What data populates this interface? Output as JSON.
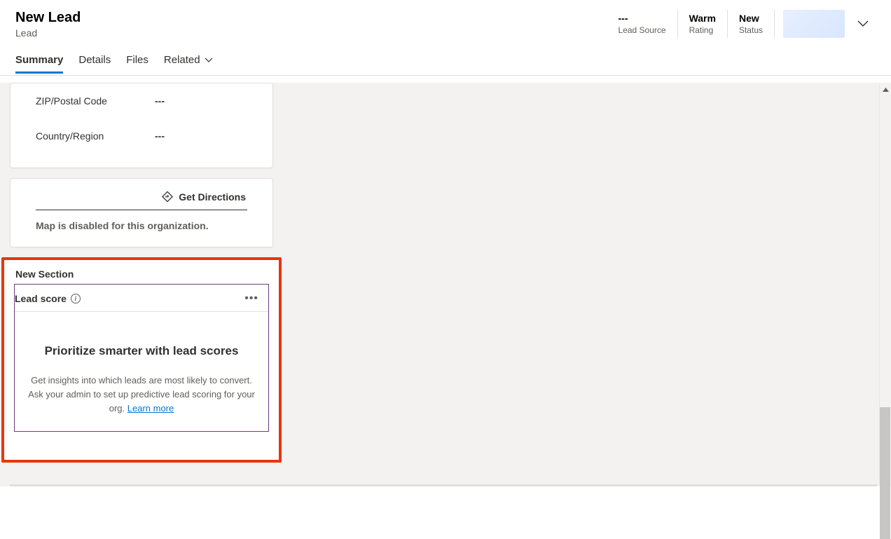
{
  "header": {
    "title": "New Lead",
    "subtitle": "Lead",
    "stats": [
      {
        "value": "---",
        "label": "Lead Source"
      },
      {
        "value": "Warm",
        "label": "Rating"
      },
      {
        "value": "New",
        "label": "Status"
      }
    ]
  },
  "tabs": {
    "summary": "Summary",
    "details": "Details",
    "files": "Files",
    "related": "Related"
  },
  "address": {
    "zip_label": "ZIP/Postal Code",
    "zip_value": "---",
    "country_label": "Country/Region",
    "country_value": "---"
  },
  "map": {
    "get_directions": "Get Directions",
    "disabled_msg": "Map is disabled for this organization."
  },
  "leadscore": {
    "section_title": "New Section",
    "title": "Lead score",
    "headline": "Prioritize smarter with lead scores",
    "description": "Get insights into which leads are most likely to convert. Ask your admin to set up predictive lead scoring for your org. ",
    "learn_more": "Learn more"
  }
}
